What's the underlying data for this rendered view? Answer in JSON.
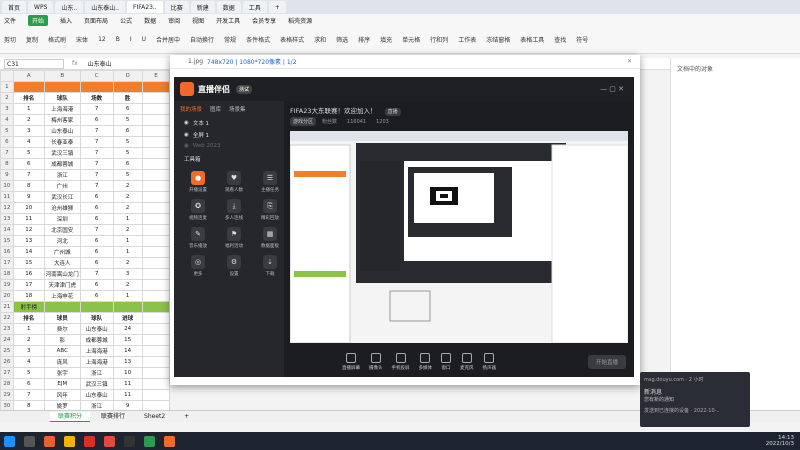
{
  "browser_tabs": [
    "首页",
    "WPS",
    "山东..",
    "山东泰山..",
    "FIFA23..",
    "比赛",
    "新建",
    "数据",
    "工具",
    "+"
  ],
  "menubar": [
    "文件",
    "开始",
    "插入",
    "页面布局",
    "公式",
    "数据",
    "审阅",
    "视图",
    "开发工具",
    "会员专享",
    "稻壳资源"
  ],
  "ribbon": [
    "剪切",
    "复制",
    "格式刷",
    "宋体",
    "12",
    "B",
    "I",
    "U",
    "合并居中",
    "自动换行",
    "常规",
    "条件格式",
    "表格样式",
    "求和",
    "筛选",
    "排序",
    "填充",
    "单元格",
    "行和列",
    "工作表",
    "冻结窗格",
    "表格工具",
    "查找",
    "符号"
  ],
  "formula": {
    "cell": "C31",
    "fx": "fx",
    "value": "山东泰山"
  },
  "sheet": {
    "cols": [
      "",
      "A",
      "B",
      "C",
      "D",
      "E"
    ],
    "table1": {
      "header": [
        "排名",
        "球队",
        "场数",
        "胜"
      ],
      "rows": [
        [
          "1",
          "上海海港",
          "7",
          "6"
        ],
        [
          "2",
          "梅州客家",
          "6",
          "5"
        ],
        [
          "3",
          "山东泰山",
          "7",
          "6"
        ],
        [
          "4",
          "长春亚泰",
          "7",
          "5"
        ],
        [
          "5",
          "武汉三镇",
          "7",
          "5"
        ],
        [
          "6",
          "成都蓉城",
          "7",
          "6"
        ],
        [
          "7",
          "浙江",
          "7",
          "5"
        ],
        [
          "8",
          "广州",
          "7",
          "2"
        ],
        [
          "9",
          "武汉长江",
          "6",
          "2"
        ],
        [
          "10",
          "沧州雄狮",
          "6",
          "2"
        ],
        [
          "11",
          "深圳",
          "6",
          "1"
        ],
        [
          "12",
          "北京国安",
          "7",
          "2"
        ],
        [
          "13",
          "河北",
          "6",
          "1"
        ],
        [
          "14",
          "广州城",
          "6",
          "1"
        ],
        [
          "15",
          "大连人",
          "6",
          "2"
        ],
        [
          "16",
          "河南嵩山龙门",
          "7",
          "3"
        ],
        [
          "17",
          "天津津门虎",
          "6",
          "2"
        ],
        [
          "18",
          "上海申花",
          "6",
          "1"
        ]
      ]
    },
    "section2_title": "射手榜",
    "table2": {
      "header": [
        "排名",
        "球员",
        "球队",
        "进球"
      ],
      "rows": [
        [
          "1",
          "费尔",
          "山东泰山",
          "24"
        ],
        [
          "2",
          "影",
          "成都蓉城",
          "15"
        ],
        [
          "3",
          "ABC",
          "上海海港",
          "14"
        ],
        [
          "4",
          "庞风",
          "上海海港",
          "13"
        ],
        [
          "5",
          "张宇",
          "浙江",
          "10"
        ],
        [
          "6",
          "EJM",
          "武汉三镇",
          "11"
        ],
        [
          "7",
          "风年",
          "山东泰山",
          "11"
        ],
        [
          "8",
          "姚罗",
          "浙江",
          "9"
        ],
        [
          "9",
          "小孙",
          "上海海港",
          "9"
        ],
        [
          "10",
          "乔云",
          "成都蓉城",
          "9"
        ]
      ]
    }
  },
  "sheet_tabs": [
    "联赛积分",
    "联赛排行",
    "Sheet2",
    "+"
  ],
  "window": {
    "title": "1.jpg",
    "path": "748x720 | 1080*720像素 | 1/2"
  },
  "app": {
    "name": "直播伴侣",
    "badge": "测试",
    "left_tabs": [
      "我的场景",
      "图库",
      "场景集"
    ],
    "scenes": [
      "文本 1",
      "全屏 1",
      "Web 2023"
    ],
    "tools_label": "工具箱",
    "tools": [
      {
        "icon": "●",
        "label": "开播设置"
      },
      {
        "icon": "♥",
        "label": "观看人数"
      },
      {
        "icon": "☰",
        "label": "主播任务"
      },
      {
        "icon": "✪",
        "label": "视频连麦"
      },
      {
        "icon": "⤓",
        "label": "多人连线"
      },
      {
        "icon": "⎘",
        "label": "精彩回放"
      },
      {
        "icon": "✎",
        "label": "音乐播放"
      },
      {
        "icon": "⚑",
        "label": "福利活动"
      },
      {
        "icon": "▦",
        "label": "数据面板"
      },
      {
        "icon": "◎",
        "label": "更多"
      },
      {
        "icon": "⚙",
        "label": "设置"
      },
      {
        "icon": "⇣",
        "label": "下载"
      }
    ],
    "room_title": "FIFA23大东联赛！欢迎加入！",
    "room_tag": "直播",
    "room_meta": [
      "游戏分区",
      "粉丝数",
      "116041",
      "1203"
    ],
    "bottom_tools": [
      "直播屏幕",
      "摄像头",
      "手机投屏",
      "多媒体",
      "窗口",
      "麦克风",
      "扬声器"
    ],
    "start_button": "开始直播"
  },
  "notification": {
    "app": "msg.douyu.com · 2 小时",
    "title": "新消息",
    "body": "您有新的通知",
    "footer": "发送到已连接的设备 · 2022-10-.."
  },
  "taskbar_time": "14:13",
  "taskbar_date": "2022/10/3",
  "right_pane_title": "文档中的对象"
}
